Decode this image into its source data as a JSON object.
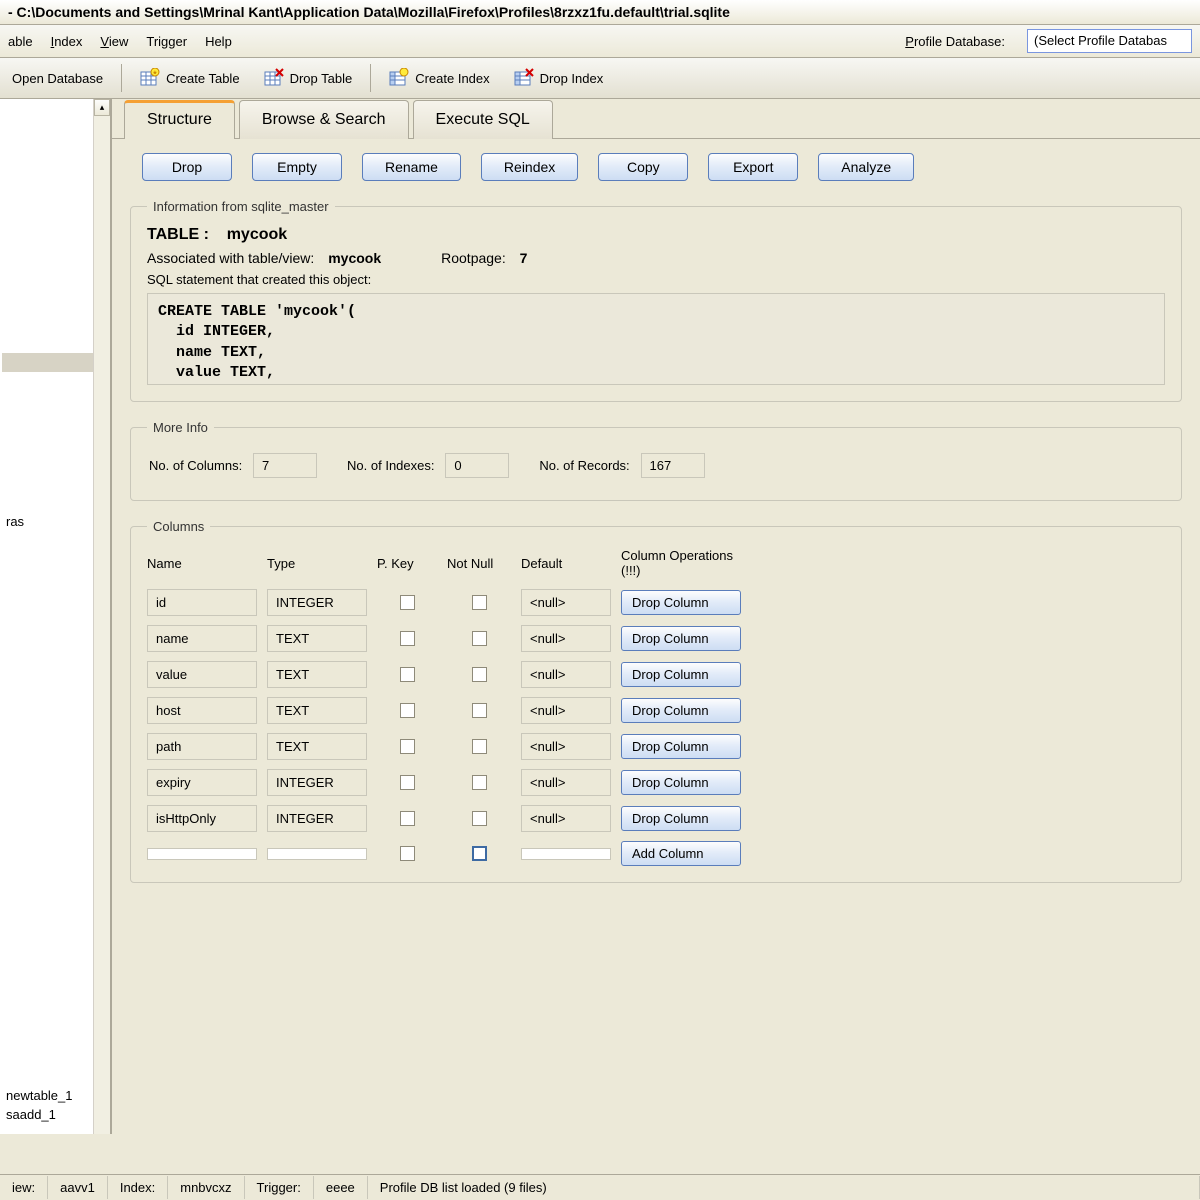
{
  "title": "- C:\\Documents and Settings\\Mrinal Kant\\Application Data\\Mozilla\\Firefox\\Profiles\\8rzxz1fu.default\\trial.sqlite",
  "menubar": {
    "table": "able",
    "index": "Index",
    "view": "View",
    "trigger": "Trigger",
    "help": "Help",
    "profile_db_label": "Profile Database:",
    "profile_db_value": "(Select Profile Databas"
  },
  "toolbar": {
    "open_db": "Open Database",
    "create_table": "Create Table",
    "drop_table": "Drop Table",
    "create_index": "Create Index",
    "drop_index": "Drop Index"
  },
  "sidebar": {
    "top_item": "",
    "mid_item": "ras",
    "bottom_items": [
      "newtable_1",
      "saadd_1"
    ]
  },
  "tabs": {
    "structure": "Structure",
    "browse": "Browse & Search",
    "execute": "Execute SQL"
  },
  "actions": {
    "drop": "Drop",
    "empty": "Empty",
    "rename": "Rename",
    "reindex": "Reindex",
    "copy": "Copy",
    "export": "Export",
    "analyze": "Analyze"
  },
  "info": {
    "legend": "Information from sqlite_master",
    "kind_label": "TABLE   :",
    "kind_value": "mycook",
    "assoc_label": "Associated with table/view:",
    "assoc_value": "mycook",
    "rootpage_label": "Rootpage:",
    "rootpage_value": "7",
    "sql_label": "SQL statement that created this object:",
    "sql": "CREATE TABLE 'mycook'(\n  id INTEGER,\n  name TEXT,\n  value TEXT,"
  },
  "moreinfo": {
    "legend": "More Info",
    "cols_label": "No. of Columns:",
    "cols_value": "7",
    "idx_label": "No. of Indexes:",
    "idx_value": "0",
    "rec_label": "No. of Records:",
    "rec_value": "167"
  },
  "columns": {
    "legend": "Columns",
    "headers": {
      "name": "Name",
      "type": "Type",
      "pkey": "P. Key",
      "notnull": "Not Null",
      "default": "Default",
      "ops": "Column Operations (!!!)"
    },
    "rows": [
      {
        "name": "id",
        "type": "INTEGER",
        "default": "<null>",
        "op": "Drop Column"
      },
      {
        "name": "name",
        "type": "TEXT",
        "default": "<null>",
        "op": "Drop Column"
      },
      {
        "name": "value",
        "type": "TEXT",
        "default": "<null>",
        "op": "Drop Column"
      },
      {
        "name": "host",
        "type": "TEXT",
        "default": "<null>",
        "op": "Drop Column"
      },
      {
        "name": "path",
        "type": "TEXT",
        "default": "<null>",
        "op": "Drop Column"
      },
      {
        "name": "expiry",
        "type": "INTEGER",
        "default": "<null>",
        "op": "Drop Column"
      },
      {
        "name": "isHttpOnly",
        "type": "INTEGER",
        "default": "<null>",
        "op": "Drop Column"
      }
    ],
    "add_label": "Add Column"
  },
  "statusbar": {
    "view_label": "iew:",
    "view_value": "aavv1",
    "index_label": "Index:",
    "index_value": "mnbvcxz",
    "trigger_label": "Trigger:",
    "trigger_value": "eeee",
    "msg": "Profile DB list loaded (9 files)"
  }
}
